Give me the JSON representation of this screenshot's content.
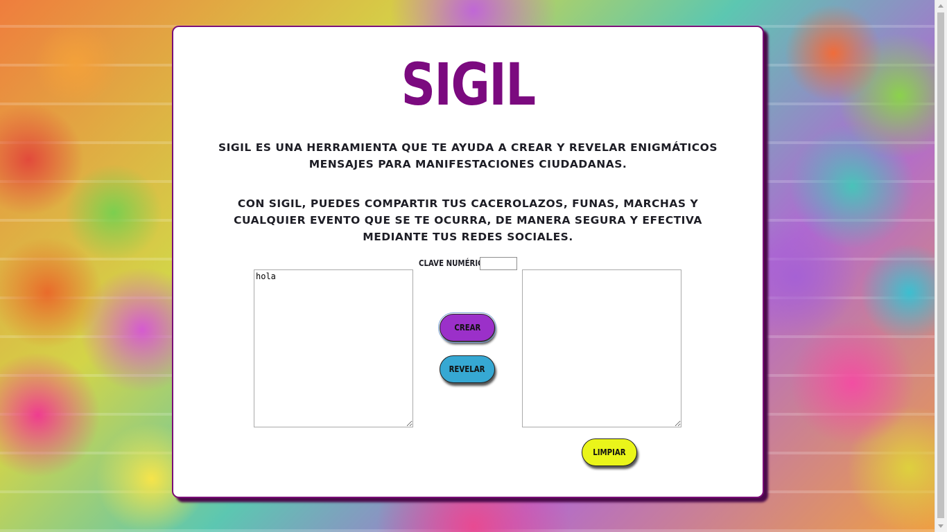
{
  "header": {
    "title": "SIGIL"
  },
  "description": {
    "paragraph1": "SIGIL ES UNA HERRAMIENTA QUE TE AYUDA A CREAR Y REVELAR ENIGMÁTICOS MENSAJES PARA MANIFESTACIONES CIUDADANAS.",
    "paragraph2": "CON SIGIL, PUEDES COMPARTIR TUS CACEROLAZOS, FUNAS, MARCHAS Y CUALQUIER EVENTO QUE SE TE OCURRA, DE MANERA SEGURA Y EFECTIVA MEDIANTE TUS REDES SOCIALES."
  },
  "form": {
    "key_label": "CLAVE NUMÉRICA",
    "key_value": "",
    "input_text": "hola",
    "output_text": "",
    "crear_label": "CREAR",
    "revelar_label": "REVELAR",
    "limpiar_label": "LIMPIAR"
  },
  "colors": {
    "title": "#7b0a7f",
    "card_border": "#7a0d77",
    "crear": "#9b30c9",
    "revelar": "#36a8d3",
    "limpiar": "#eaf51a"
  }
}
